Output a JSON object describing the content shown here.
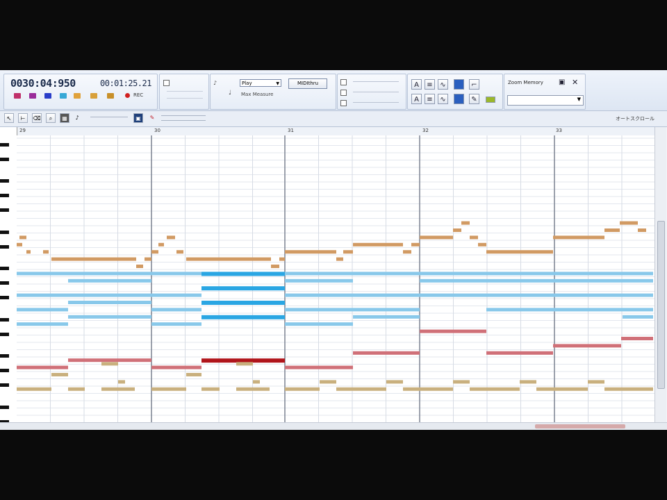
{
  "transport": {
    "counter": "0030:04:950",
    "clock": "00:01:25.21",
    "rec_label": "REC"
  },
  "tempo_panel": {
    "play_select": "Play",
    "midi_button": "MIDIthru",
    "max_measures": "Max Measure"
  },
  "zoom": {
    "label": "Zoom Memory"
  },
  "roll": {
    "autoscroll_label": "オートスクロール",
    "measures": [
      "29",
      "30",
      "31",
      "32",
      "33"
    ]
  },
  "colors": {
    "orange": "#d19a63",
    "blue": "#88c8ea",
    "blue_dark": "#2aa6e3",
    "red": "#d07078",
    "red_dark": "#b0141a",
    "tan": "#c9b07e"
  },
  "notes": [
    {
      "t": "o",
      "r": 1,
      "s": 28,
      "e": 38
    },
    {
      "t": "o",
      "r": 2,
      "s": 22,
      "e": 32
    },
    {
      "t": "o",
      "r": 3,
      "s": 38,
      "e": 44
    },
    {
      "t": "o",
      "r": 3,
      "s": 62,
      "e": 70
    },
    {
      "t": "o",
      "r": 4,
      "s": 74,
      "e": 196
    },
    {
      "t": "o",
      "r": 5,
      "s": 196,
      "e": 206
    },
    {
      "t": "o",
      "r": 4,
      "s": 208,
      "e": 218
    },
    {
      "t": "o",
      "r": 3,
      "s": 218,
      "e": 228
    },
    {
      "t": "o",
      "r": 2,
      "s": 228,
      "e": 236
    },
    {
      "t": "o",
      "r": 1,
      "s": 240,
      "e": 252
    },
    {
      "t": "o",
      "r": 3,
      "s": 254,
      "e": 264
    },
    {
      "t": "o",
      "r": 4,
      "s": 268,
      "e": 390
    },
    {
      "t": "o",
      "r": 5,
      "s": 390,
      "e": 402
    },
    {
      "t": "o",
      "r": 4,
      "s": 402,
      "e": 410
    },
    {
      "t": "o",
      "r": 3,
      "s": 410,
      "e": 484
    },
    {
      "t": "o",
      "r": 4,
      "s": 484,
      "e": 494
    },
    {
      "t": "o",
      "r": 3,
      "s": 494,
      "e": 508
    },
    {
      "t": "o",
      "r": 2,
      "s": 508,
      "e": 580
    },
    {
      "t": "o",
      "r": 3,
      "s": 580,
      "e": 592
    },
    {
      "t": "o",
      "r": 2,
      "s": 592,
      "e": 604
    },
    {
      "t": "o",
      "r": 1,
      "s": 604,
      "e": 652
    },
    {
      "t": "o",
      "r": 0,
      "s": 652,
      "e": 664
    },
    {
      "t": "o",
      "r": -1,
      "s": 664,
      "e": 676
    },
    {
      "t": "o",
      "r": 1,
      "s": 676,
      "e": 688
    },
    {
      "t": "o",
      "r": 2,
      "s": 688,
      "e": 700
    },
    {
      "t": "o",
      "r": 3,
      "s": 700,
      "e": 796
    },
    {
      "t": "o",
      "r": 1,
      "s": 796,
      "e": 870
    },
    {
      "t": "o",
      "r": 0,
      "s": 870,
      "e": 892
    },
    {
      "t": "o",
      "r": -1,
      "s": 892,
      "e": 918
    },
    {
      "t": "o",
      "r": 0,
      "s": 918,
      "e": 930
    },
    {
      "t": "b",
      "r": 6,
      "s": 24,
      "e": 98
    },
    {
      "t": "b",
      "r": 6,
      "s": 98,
      "e": 218
    },
    {
      "t": "b",
      "r": 6,
      "s": 218,
      "e": 290
    },
    {
      "t": "bd",
      "r": 6,
      "s": 290,
      "e": 410
    },
    {
      "t": "b",
      "r": 6,
      "s": 410,
      "e": 940
    },
    {
      "t": "b",
      "r": 7,
      "s": 98,
      "e": 218
    },
    {
      "t": "b",
      "r": 7,
      "s": 410,
      "e": 508
    },
    {
      "t": "b",
      "r": 7,
      "s": 604,
      "e": 940
    },
    {
      "t": "bd",
      "r": 8,
      "s": 290,
      "e": 410
    },
    {
      "t": "b",
      "r": 9,
      "s": 24,
      "e": 218
    },
    {
      "t": "b",
      "r": 9,
      "s": 218,
      "e": 290
    },
    {
      "t": "b",
      "r": 9,
      "s": 410,
      "e": 940
    },
    {
      "t": "b",
      "r": 10,
      "s": 98,
      "e": 218
    },
    {
      "t": "bd",
      "r": 10,
      "s": 290,
      "e": 410
    },
    {
      "t": "b",
      "r": 11,
      "s": 24,
      "e": 98
    },
    {
      "t": "b",
      "r": 11,
      "s": 218,
      "e": 290
    },
    {
      "t": "b",
      "r": 11,
      "s": 410,
      "e": 604
    },
    {
      "t": "b",
      "r": 11,
      "s": 700,
      "e": 940
    },
    {
      "t": "bd",
      "r": 12,
      "s": 290,
      "e": 410
    },
    {
      "t": "b",
      "r": 12,
      "s": 98,
      "e": 218
    },
    {
      "t": "b",
      "r": 12,
      "s": 508,
      "e": 604
    },
    {
      "t": "b",
      "r": 12,
      "s": 896,
      "e": 940
    },
    {
      "t": "b",
      "r": 13,
      "s": 24,
      "e": 98
    },
    {
      "t": "b",
      "r": 13,
      "s": 218,
      "e": 290
    },
    {
      "t": "b",
      "r": 13,
      "s": 410,
      "e": 508
    },
    {
      "t": "r",
      "r": 14,
      "s": 604,
      "e": 700
    },
    {
      "t": "r",
      "r": 15,
      "s": 894,
      "e": 940
    },
    {
      "t": "r",
      "r": 16,
      "s": 796,
      "e": 894
    },
    {
      "t": "r",
      "r": 17,
      "s": 508,
      "e": 604
    },
    {
      "t": "r",
      "r": 17,
      "s": 700,
      "e": 796
    },
    {
      "t": "r",
      "r": 18,
      "s": 98,
      "e": 218
    },
    {
      "t": "rd",
      "r": 18,
      "s": 290,
      "e": 410
    },
    {
      "t": "r",
      "r": 19,
      "s": 24,
      "e": 98
    },
    {
      "t": "r",
      "r": 19,
      "s": 218,
      "e": 290
    },
    {
      "t": "r",
      "r": 19,
      "s": 410,
      "e": 508
    },
    {
      "t": "n",
      "r": 18.5,
      "s": 146,
      "e": 170
    },
    {
      "t": "n",
      "r": 18.5,
      "s": 340,
      "e": 364
    },
    {
      "t": "n",
      "r": 20,
      "s": 74,
      "e": 98
    },
    {
      "t": "n",
      "r": 20,
      "s": 268,
      "e": 290
    },
    {
      "t": "n",
      "r": 21,
      "s": 170,
      "e": 180
    },
    {
      "t": "n",
      "r": 21,
      "s": 364,
      "e": 374
    },
    {
      "t": "n",
      "r": 21,
      "s": 460,
      "e": 484
    },
    {
      "t": "n",
      "r": 21,
      "s": 556,
      "e": 580
    },
    {
      "t": "n",
      "r": 21,
      "s": 652,
      "e": 676
    },
    {
      "t": "n",
      "r": 21,
      "s": 748,
      "e": 772
    },
    {
      "t": "n",
      "r": 21,
      "s": 846,
      "e": 870
    },
    {
      "t": "n",
      "r": 22,
      "s": 24,
      "e": 74
    },
    {
      "t": "n",
      "r": 22,
      "s": 98,
      "e": 122
    },
    {
      "t": "n",
      "r": 22,
      "s": 146,
      "e": 194
    },
    {
      "t": "n",
      "r": 22,
      "s": 218,
      "e": 268
    },
    {
      "t": "n",
      "r": 22,
      "s": 290,
      "e": 316
    },
    {
      "t": "n",
      "r": 22,
      "s": 340,
      "e": 388
    },
    {
      "t": "n",
      "r": 22,
      "s": 410,
      "e": 460
    },
    {
      "t": "n",
      "r": 22,
      "s": 484,
      "e": 556
    },
    {
      "t": "n",
      "r": 22,
      "s": 580,
      "e": 652
    },
    {
      "t": "n",
      "r": 22,
      "s": 676,
      "e": 748
    },
    {
      "t": "n",
      "r": 22,
      "s": 772,
      "e": 846
    },
    {
      "t": "n",
      "r": 22,
      "s": 870,
      "e": 940
    }
  ]
}
